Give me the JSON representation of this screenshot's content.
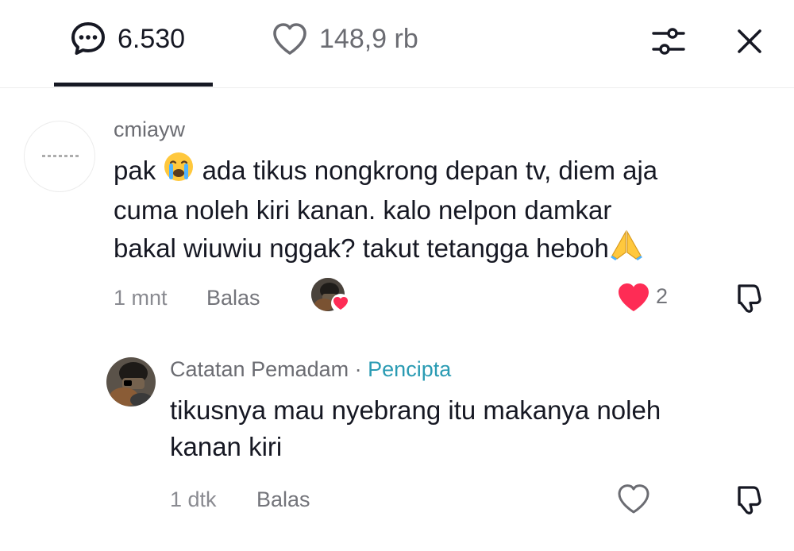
{
  "header": {
    "comment_count": "6.530",
    "like_count": "148,9 rb",
    "icons": [
      "comment-bubble-icon",
      "heart-outline-icon",
      "filter-sliders-icon",
      "close-icon"
    ]
  },
  "comments": [
    {
      "username": "cmiayw",
      "text_line1_before": "pak",
      "text_line1_emoji": "crying-face-emoji",
      "text_line1_after": "ada tikus nongkrong depan tv, diem aja",
      "text_line2": "cuma noleh kiri kanan. kalo nelpon damkar",
      "text_line3": "bakal wiuwiu nggak? takut tetangga heboh",
      "text_line3_emoji": "folded-hands-emoji",
      "time": "1 mnt",
      "reply_label": "Balas",
      "like_count": "2",
      "liked": true
    },
    {
      "username": "Catatan Pemadam",
      "separator": "·",
      "badge": "Pencipta",
      "text_line1": "tikusnya mau nyebrang itu makanya noleh",
      "text_line2": "kanan kiri",
      "time": "1 dtk",
      "reply_label": "Balas",
      "liked": false
    }
  ],
  "colors": {
    "like_red": "#fe2c55",
    "creator_teal": "#2a9bb3",
    "text_dark": "#161823",
    "text_muted": "#8a8b91"
  }
}
